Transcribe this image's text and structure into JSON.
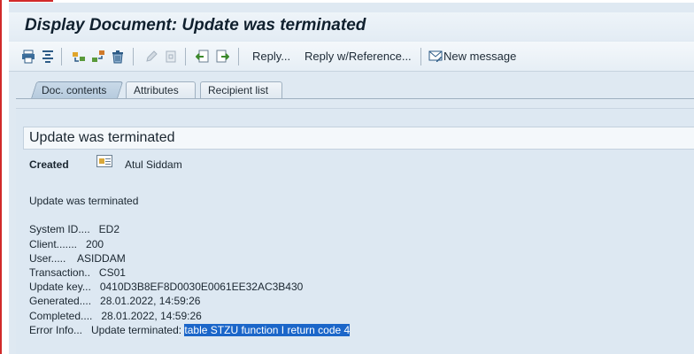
{
  "window": {
    "title": "Display Document: Update was terminated"
  },
  "toolbar": {
    "reply_label": "Reply...",
    "reply_ref_label": "Reply w/Reference...",
    "new_message_label": "New message"
  },
  "tabs": [
    {
      "label": "Doc. contents",
      "active": true
    },
    {
      "label": "Attributes",
      "active": false
    },
    {
      "label": "Recipient list",
      "active": false
    }
  ],
  "document": {
    "subject": "Update was terminated",
    "created_label": "Created",
    "created_by": "Atul Siddam",
    "body_heading": "Update was terminated",
    "lines": [
      "System ID....   ED2",
      "Client.......   200",
      "User.....    ASIDDAM",
      "Transaction..   CS01",
      "Update key...   0410D3B8EF8D0030E0061EE32AC3B430",
      "Generated....   28.01.2022, 14:59:26",
      "Completed....   28.01.2022, 14:59:26"
    ],
    "error_prefix": "Error Info...   Update terminated: ",
    "error_highlight": "table STZU function I return code 4"
  },
  "colors": {
    "selection": "#1b66c9",
    "background": "#dfe9f2",
    "accent_red": "#d12a2a"
  }
}
